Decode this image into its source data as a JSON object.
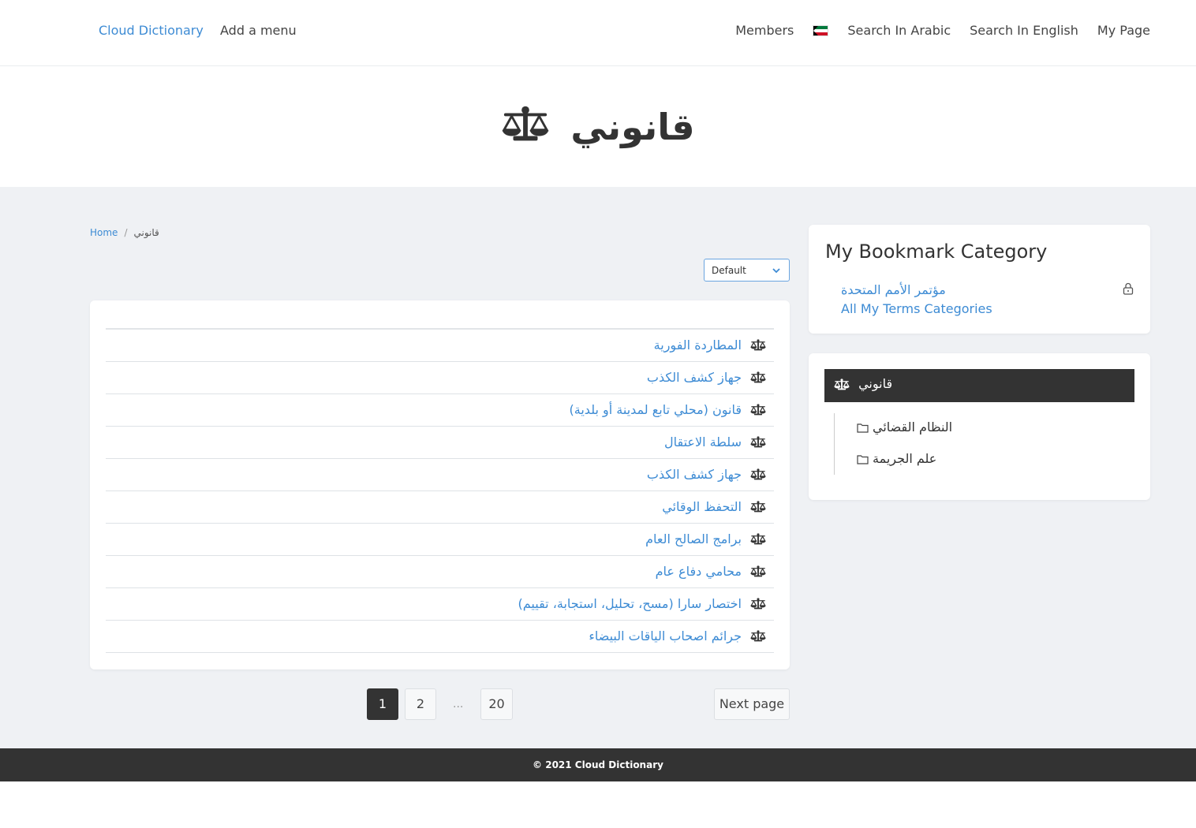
{
  "nav": {
    "brand": "Cloud Dictionary",
    "add_menu": "Add a menu",
    "members": "Members",
    "flag_icon": "kuwait-flag-icon",
    "search_arabic": "Search In Arabic",
    "search_english": "Search In English",
    "my_page": "My Page"
  },
  "hero": {
    "title": "قانوني",
    "icon": "balance-scale-icon"
  },
  "breadcrumb": {
    "home": "Home",
    "separator": "/",
    "current": "قانوني"
  },
  "sort": {
    "selected": "Default",
    "icon": "chevron-down-icon"
  },
  "terms": [
    "المطاردة الفورية",
    "جهاز كشف الكذب",
    "قانون (محلي تابع لمدينة أو بلدية)",
    "سلطة الاعتقال",
    "جهاز كشف الكذب",
    "التحفظ الوقائي",
    "برامج الصالح العام",
    "محامي دفاع عام",
    "اختصار سارا (مسح، تحليل، استجابة، تقييم)",
    "جرائم اصحاب الياقات البيضاء"
  ],
  "pagination": {
    "pages": [
      "1",
      "2",
      "20"
    ],
    "ellipsis": "...",
    "active": "1",
    "next": "Next page"
  },
  "bookmark": {
    "title": "My Bookmark Category",
    "link1": "مؤتمر الأمم المتحدة",
    "link2": "All My Terms Categories",
    "lock_icon": "lock-icon"
  },
  "category": {
    "header": "قانوني",
    "subs": [
      "النظام القضائي",
      "علم الجريمة"
    ],
    "folder_icon": "folder-icon"
  },
  "colors": {
    "link": "#3d8bd4",
    "dark": "#333333",
    "background": "#eff1f4"
  },
  "footer": {
    "text": "© 2021 Cloud Dictionary"
  }
}
